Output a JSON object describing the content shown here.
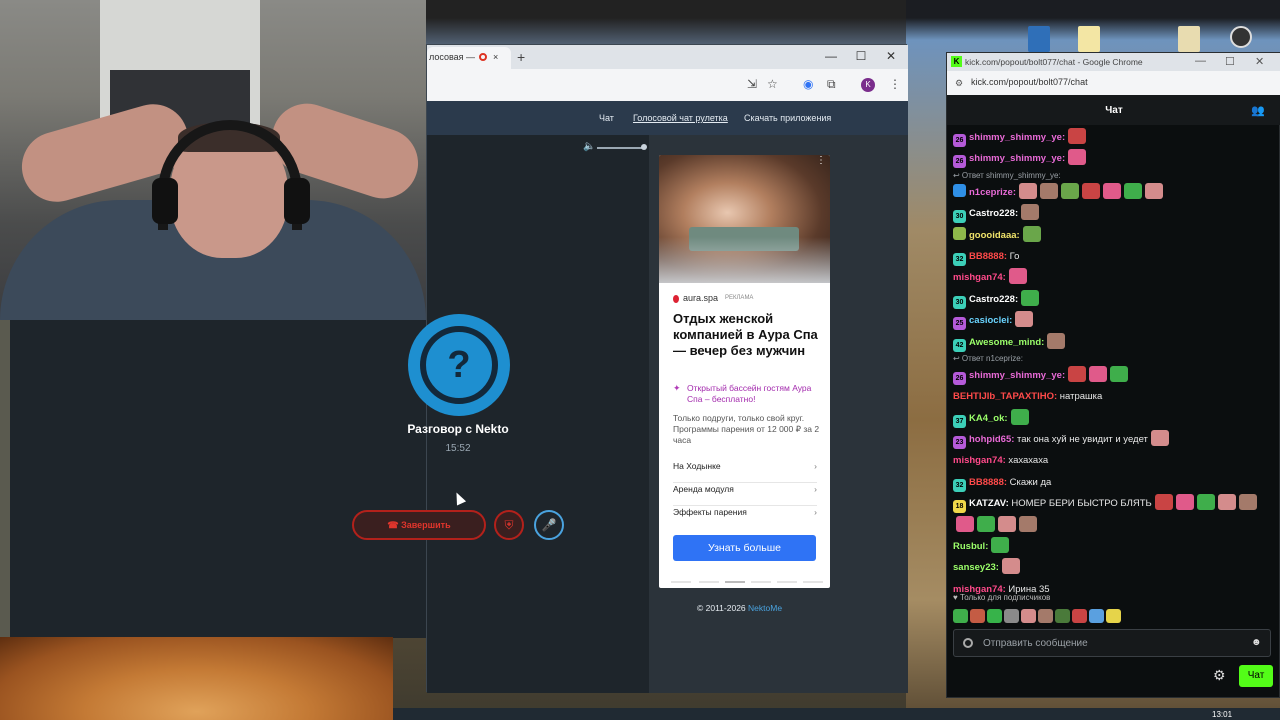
{
  "browser": {
    "tab_label": "лосовая —",
    "tab_close": "×",
    "new_tab": "+",
    "win_min": "—",
    "win_max": "☐",
    "win_close": "✕",
    "profile_initial": "K",
    "nav": [
      "Чат",
      "Голосовой чат рулетка",
      "Скачать приложения"
    ]
  },
  "call": {
    "avatar_glyph": "?",
    "title": "Разговор с Nekto",
    "timer": "15:52",
    "end_label": "Завершить",
    "shield_glyph": "⛨",
    "mic_glyph": "🎤"
  },
  "ad": {
    "brand": "aura.spa",
    "tag": "РЕКЛАМА",
    "title": "Отдых женской компанией в Аура Спа — вечер без мужчин",
    "promo": "Открытый бассейн гостям Аура Спа – бесплатно!",
    "description": "Только подруги, только свой круг. Программы парения от 12 000 ₽ за 2 часа",
    "links": [
      "На Ходынке",
      "Аренда модуля",
      "Эффекты парения"
    ],
    "cta": "Узнать больше",
    "menu_dots": "⋮"
  },
  "footer": {
    "copyright": "© 2011-2026",
    "link": "NektoMe"
  },
  "chat_window": {
    "window_title": "kick.com/popout/bolt077/chat - Google Chrome",
    "url": "kick.com/popout/bolt077/chat",
    "header": "Чат",
    "subs_note": "♥ Только для подписчиков",
    "placeholder": "Отправить сообщение",
    "send_label": "Чат",
    "messages": [
      {
        "badge": "26",
        "badge_color": "#b55ad9",
        "user": "shimmy_shimmy_ye",
        "user_color": "#e86ad6",
        "text": "",
        "emotes": 1,
        "reply": false
      },
      {
        "badge": "26",
        "badge_color": "#b55ad9",
        "user": "shimmy_shimmy_ye",
        "user_color": "#e86ad6",
        "text": "",
        "emotes": 1,
        "reply": false
      },
      {
        "reply": true,
        "text": "Ответ shimmy_shimmy_ye:"
      },
      {
        "badge": "",
        "badge_color": "#2f8fe6",
        "user": "n1ceprize",
        "user_color": "#e86ad6",
        "text": "",
        "emotes": 7,
        "reply": false
      },
      {
        "badge": "30",
        "badge_color": "#3ccfb8",
        "user": "Castro228",
        "user_color": "#ffffff",
        "text": "",
        "emotes": 1,
        "reply": false
      },
      {
        "badge": "",
        "badge_color": "#8fb84a",
        "user": "goooidaaa",
        "user_color": "#f0e36a",
        "text": "",
        "emotes": 1,
        "reply": false
      },
      {
        "badge": "32",
        "badge_color": "#3ccfb8",
        "user": "BB8888",
        "user_color": "#ff4a4a",
        "text": "Го",
        "emotes": 0,
        "reply": false
      },
      {
        "badge": "",
        "badge_color": "",
        "user": "mishgan74",
        "user_color": "#ff4a8a",
        "text": "",
        "emotes": 1,
        "reply": false
      },
      {
        "badge": "30",
        "badge_color": "#3ccfb8",
        "user": "Castro228",
        "user_color": "#ffffff",
        "text": "",
        "emotes": 1,
        "reply": false
      },
      {
        "badge": "25",
        "badge_color": "#b55ad9",
        "user": "casioclei",
        "user_color": "#6ad4ff",
        "text": "",
        "emotes": 1,
        "reply": false
      },
      {
        "badge": "42",
        "badge_color": "#3ccfb8",
        "user": "Awesome_mind",
        "user_color": "#9bff6a",
        "text": "",
        "emotes": 1,
        "reply": false
      },
      {
        "reply": true,
        "text": "Ответ n1ceprize:"
      },
      {
        "badge": "26",
        "badge_color": "#b55ad9",
        "user": "shimmy_shimmy_ye",
        "user_color": "#e86ad6",
        "text": "",
        "emotes": 3,
        "reply": false
      },
      {
        "badge": "",
        "badge_color": "",
        "user": "BEHTIJIb_TAPAXTIHO",
        "user_color": "#ff4a4a",
        "text": "натрашка",
        "emotes": 0,
        "reply": false
      },
      {
        "badge": "37",
        "badge_color": "#3ccfb8",
        "user": "KA4_ok",
        "user_color": "#9bff6a",
        "text": "",
        "emotes": 1,
        "reply": false
      },
      {
        "badge": "23",
        "badge_color": "#b55ad9",
        "user": "hohpid65",
        "user_color": "#e86ad6",
        "text": "так она хуй не увидит и уедет",
        "emotes": 1,
        "reply": false
      },
      {
        "badge": "",
        "badge_color": "",
        "user": "mishgan74",
        "user_color": "#ff4a8a",
        "text": "хахахаха",
        "emotes": 0,
        "reply": false
      },
      {
        "badge": "32",
        "badge_color": "#3ccfb8",
        "user": "BB8888",
        "user_color": "#ff4a4a",
        "text": "Скажи да",
        "emotes": 0,
        "reply": false
      },
      {
        "badge": "18",
        "badge_color": "#f0d84a",
        "user": "KATZAV",
        "user_color": "#ffffff",
        "text": "НОМЕР БЕРИ БЫСТРО БЛЯТЬ",
        "emotes": 5,
        "reply": false
      },
      {
        "badge": "",
        "badge_color": "",
        "user": "",
        "user_color": "#ffffff",
        "text": "",
        "emotes": 4,
        "reply": false
      },
      {
        "badge": "",
        "badge_color": "",
        "user": "Rusbul",
        "user_color": "#9bff6a",
        "text": "",
        "emotes": 1,
        "reply": false
      },
      {
        "badge": "",
        "badge_color": "",
        "user": "sansey23",
        "user_color": "#9bff6a",
        "text": "",
        "emotes": 1,
        "reply": false
      },
      {
        "badge": "",
        "badge_color": "",
        "user": "mishgan74",
        "user_color": "#ff4a8a",
        "text": "Ирина 35",
        "emotes": 0,
        "reply": false
      }
    ]
  },
  "taskbar": {
    "clock": "13:01"
  },
  "colors": {
    "kick_green": "#53fc18",
    "nekto_blue": "#1e8fd0",
    "end_red": "#e0352c",
    "cta_blue": "#2f73f5"
  }
}
